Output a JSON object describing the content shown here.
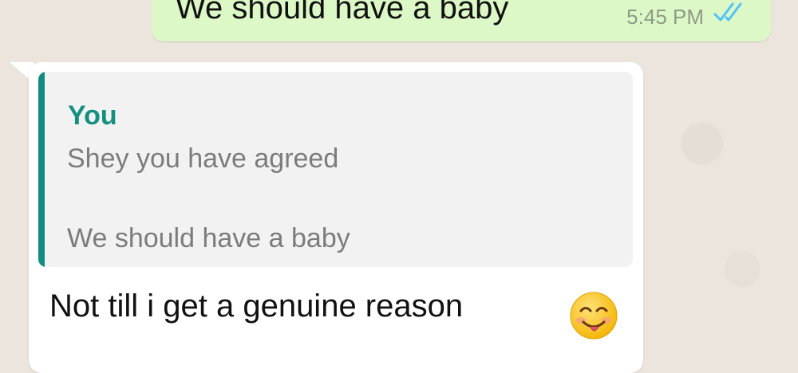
{
  "chat": {
    "outgoing": {
      "text": "We should have a baby",
      "time": "5:45 PM",
      "status_icon": "double-check-icon"
    },
    "incoming": {
      "quoted": {
        "author": "You",
        "line1": "Shey you have agreed",
        "line2": "We should have a baby"
      },
      "text": "Not till i get a genuine reason",
      "emoji": "smiling-face-icon"
    }
  },
  "colors": {
    "background": "#ece5dd",
    "outgoing_bubble": "#dcf8c6",
    "incoming_bubble": "#ffffff",
    "quote_accent": "#128c7e",
    "read_ticks": "#4fc3f7"
  }
}
